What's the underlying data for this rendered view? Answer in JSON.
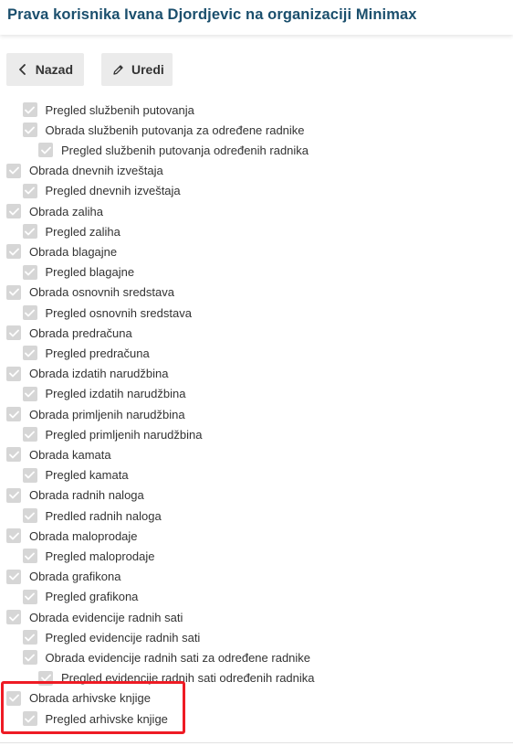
{
  "header": {
    "title": "Prava korisnika Ivana Djordjevic na organizaciji Minimax"
  },
  "toolbar": {
    "back_label": "Nazad",
    "edit_label": "Uredi"
  },
  "permissions": [
    {
      "label": "Pregled službenih putovanja",
      "level": 1,
      "checked": true
    },
    {
      "label": "Obrada službenih putovanja za određene radnike",
      "level": 1,
      "checked": true
    },
    {
      "label": "Pregled službenih putovanja određenih radnika",
      "level": 2,
      "checked": true
    },
    {
      "label": "Obrada dnevnih izveštaja",
      "level": 0,
      "checked": true
    },
    {
      "label": "Pregled dnevnih izveštaja",
      "level": 1,
      "checked": true
    },
    {
      "label": "Obrada zaliha",
      "level": 0,
      "checked": true
    },
    {
      "label": "Pregled zaliha",
      "level": 1,
      "checked": true
    },
    {
      "label": "Obrada blagajne",
      "level": 0,
      "checked": true
    },
    {
      "label": "Pregled blagajne",
      "level": 1,
      "checked": true
    },
    {
      "label": "Obrada osnovnih sredstava",
      "level": 0,
      "checked": true
    },
    {
      "label": "Pregled osnovnih sredstava",
      "level": 1,
      "checked": true
    },
    {
      "label": "Obrada predračuna",
      "level": 0,
      "checked": true
    },
    {
      "label": "Pregled predračuna",
      "level": 1,
      "checked": true
    },
    {
      "label": "Obrada izdatih narudžbina",
      "level": 0,
      "checked": true
    },
    {
      "label": "Pregled izdatih narudžbina",
      "level": 1,
      "checked": true
    },
    {
      "label": "Obrada primljenih narudžbina",
      "level": 0,
      "checked": true
    },
    {
      "label": "Pregled primljenih narudžbina",
      "level": 1,
      "checked": true
    },
    {
      "label": "Obrada kamata",
      "level": 0,
      "checked": true
    },
    {
      "label": "Pregled kamata",
      "level": 1,
      "checked": true
    },
    {
      "label": "Obrada radnih naloga",
      "level": 0,
      "checked": true
    },
    {
      "label": "Predled radnih naloga",
      "level": 1,
      "checked": true
    },
    {
      "label": "Obrada maloprodaje",
      "level": 0,
      "checked": true
    },
    {
      "label": "Pregled maloprodaje",
      "level": 1,
      "checked": true
    },
    {
      "label": "Obrada grafikona",
      "level": 0,
      "checked": true
    },
    {
      "label": "Pregled grafikona",
      "level": 1,
      "checked": true
    },
    {
      "label": "Obrada evidencije radnih sati",
      "level": 0,
      "checked": true
    },
    {
      "label": "Pregled evidencije radnih sati",
      "level": 1,
      "checked": true
    },
    {
      "label": "Obrada evidencije radnih sati za određene radnike",
      "level": 1,
      "checked": true
    },
    {
      "label": "Pregled evidencije radnih sati određenih radnika",
      "level": 2,
      "checked": true
    },
    {
      "label": "Obrada arhivske knjige",
      "level": 0,
      "checked": true
    },
    {
      "label": "Pregled arhivske knjige",
      "level": 1,
      "checked": true
    }
  ],
  "colors": {
    "title": "#1b4f6d",
    "button_bg": "#ebebeb",
    "checkbox": "#d6d6d6",
    "checkmark": "#ffffff",
    "highlight": "#ee1b24"
  }
}
